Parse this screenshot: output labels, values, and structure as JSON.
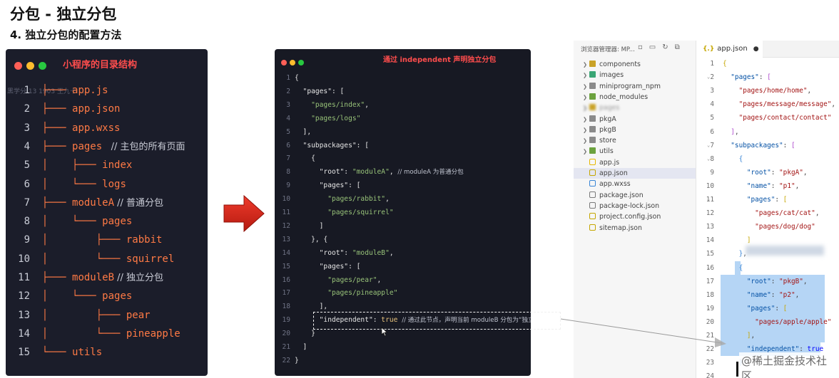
{
  "header": {
    "title": "分包 - 独立分包",
    "subtitle": "4. 独立分包的配置方法"
  },
  "tree_panel": {
    "title": "小程序的目录结构",
    "watermark": "黑学分 13 1903 王九十 ...",
    "lines": [
      {
        "num": "1",
        "prefix": "├─── ",
        "text": "app.js",
        "comment": ""
      },
      {
        "num": "2",
        "prefix": "├─── ",
        "text": "app.json",
        "comment": ""
      },
      {
        "num": "3",
        "prefix": "├─── ",
        "text": "app.wxss",
        "comment": ""
      },
      {
        "num": "4",
        "prefix": "├─── ",
        "text": "pages",
        "comment": "   // 主包的所有页面"
      },
      {
        "num": "5",
        "prefix": "│    ├─── ",
        "text": "index",
        "comment": ""
      },
      {
        "num": "6",
        "prefix": "│    └─── ",
        "text": "logs",
        "comment": ""
      },
      {
        "num": "7",
        "prefix": "├─── ",
        "text": "moduleA",
        "comment": " // 普通分包"
      },
      {
        "num": "8",
        "prefix": "│    └─── ",
        "text": "pages",
        "comment": ""
      },
      {
        "num": "9",
        "prefix": "│        ├─── ",
        "text": "rabbit",
        "comment": ""
      },
      {
        "num": "10",
        "prefix": "│        └─── ",
        "text": "squirrel",
        "comment": ""
      },
      {
        "num": "11",
        "prefix": "├─── ",
        "text": "moduleB",
        "comment": " // 独立分包"
      },
      {
        "num": "12",
        "prefix": "│    └─── ",
        "text": "pages",
        "comment": ""
      },
      {
        "num": "13",
        "prefix": "│        ├─── ",
        "text": "pear",
        "comment": ""
      },
      {
        "num": "14",
        "prefix": "│        └─── ",
        "text": "pineapple",
        "comment": ""
      },
      {
        "num": "15",
        "prefix": "└─── ",
        "text": "utils",
        "comment": ""
      }
    ]
  },
  "code_panel": {
    "title": "通过 independent 声明独立分包",
    "lines": [
      {
        "num": "1",
        "parts": [
          {
            "c": "k",
            "t": "{"
          }
        ]
      },
      {
        "num": "2",
        "parts": [
          {
            "c": "k",
            "t": "  \"pages\": ["
          }
        ]
      },
      {
        "num": "3",
        "parts": [
          {
            "c": "s",
            "t": "    \"pages/index\""
          },
          {
            "c": "k",
            "t": ","
          }
        ]
      },
      {
        "num": "4",
        "parts": [
          {
            "c": "s",
            "t": "    \"pages/logs\""
          }
        ]
      },
      {
        "num": "5",
        "parts": [
          {
            "c": "k",
            "t": "  ],"
          }
        ]
      },
      {
        "num": "6",
        "parts": [
          {
            "c": "k",
            "t": "  \"subpackages\": ["
          }
        ]
      },
      {
        "num": "7",
        "parts": [
          {
            "c": "k",
            "t": "    {"
          }
        ]
      },
      {
        "num": "8",
        "parts": [
          {
            "c": "k",
            "t": "      \"root\": "
          },
          {
            "c": "s",
            "t": "\"moduleA\""
          },
          {
            "c": "k",
            "t": ", "
          },
          {
            "c": "c",
            "t": "// moduleA 为普通分包"
          }
        ]
      },
      {
        "num": "9",
        "parts": [
          {
            "c": "k",
            "t": "      \"pages\": ["
          }
        ]
      },
      {
        "num": "10",
        "parts": [
          {
            "c": "s",
            "t": "        \"pages/rabbit\""
          },
          {
            "c": "k",
            "t": ","
          }
        ]
      },
      {
        "num": "11",
        "parts": [
          {
            "c": "s",
            "t": "        \"pages/squirrel\""
          }
        ]
      },
      {
        "num": "12",
        "parts": [
          {
            "c": "k",
            "t": "      ]"
          }
        ]
      },
      {
        "num": "13",
        "parts": [
          {
            "c": "k",
            "t": "    }, {"
          }
        ]
      },
      {
        "num": "14",
        "parts": [
          {
            "c": "k",
            "t": "      \"root\": "
          },
          {
            "c": "s",
            "t": "\"moduleB\""
          },
          {
            "c": "k",
            "t": ","
          }
        ]
      },
      {
        "num": "15",
        "parts": [
          {
            "c": "k",
            "t": "      \"pages\": ["
          }
        ]
      },
      {
        "num": "16",
        "parts": [
          {
            "c": "s",
            "t": "        \"pages/pear\""
          },
          {
            "c": "k",
            "t": ","
          }
        ]
      },
      {
        "num": "17",
        "parts": [
          {
            "c": "s",
            "t": "        \"pages/pineapple\""
          }
        ]
      },
      {
        "num": "18",
        "parts": [
          {
            "c": "k",
            "t": "      ],"
          }
        ]
      },
      {
        "num": "19",
        "parts": [
          {
            "c": "k",
            "t": "      \"independent\": "
          },
          {
            "c": "b",
            "t": "true"
          },
          {
            "c": "k",
            "t": " "
          },
          {
            "c": "c",
            "t": "// 通过此节点，声明当前 moduleB 分包为“独立分包”"
          }
        ]
      },
      {
        "num": "20",
        "parts": [
          {
            "c": "k",
            "t": "    }"
          }
        ]
      },
      {
        "num": "21",
        "parts": [
          {
            "c": "k",
            "t": "  ]"
          }
        ]
      },
      {
        "num": "22",
        "parts": [
          {
            "c": "k",
            "t": "}"
          }
        ]
      }
    ]
  },
  "explorer": {
    "header": "浏览器管理器: MP...",
    "items": [
      {
        "label": "components",
        "chevron": true,
        "icon": "folder-icon",
        "color": "#c9a227",
        "active": false,
        "blur": false
      },
      {
        "label": "images",
        "chevron": true,
        "icon": "folder-icon",
        "color": "#3aa675",
        "active": false,
        "blur": false
      },
      {
        "label": "miniprogram_npm",
        "chevron": true,
        "icon": "folder-icon",
        "color": "#8a8a8a",
        "active": false,
        "blur": false
      },
      {
        "label": "node_modules",
        "chevron": true,
        "icon": "folder-icon",
        "color": "#6ca23e",
        "active": false,
        "blur": false
      },
      {
        "label": "pages",
        "chevron": true,
        "icon": "folder-icon",
        "color": "#c9a227",
        "active": false,
        "blur": true
      },
      {
        "label": "pkgA",
        "chevron": true,
        "icon": "folder-icon",
        "color": "#8a8a8a",
        "active": false,
        "blur": false
      },
      {
        "label": "pkgB",
        "chevron": true,
        "icon": "folder-icon",
        "color": "#8a8a8a",
        "active": false,
        "blur": false
      },
      {
        "label": "store",
        "chevron": true,
        "icon": "folder-icon",
        "color": "#8a8a8a",
        "active": false,
        "blur": false
      },
      {
        "label": "utils",
        "chevron": true,
        "icon": "folder-icon",
        "color": "#6ca23e",
        "active": false,
        "blur": false
      },
      {
        "label": "app.js",
        "chevron": false,
        "icon": "js-file-icon",
        "color": "#e6b800",
        "active": false,
        "blur": false
      },
      {
        "label": "app.json",
        "chevron": false,
        "icon": "json-file-icon",
        "color": "#c5a600",
        "active": true,
        "blur": false
      },
      {
        "label": "app.wxss",
        "chevron": false,
        "icon": "css-file-icon",
        "color": "#3a86d6",
        "active": false,
        "blur": false
      },
      {
        "label": "package.json",
        "chevron": false,
        "icon": "npm-file-icon",
        "color": "#7a7a7a",
        "active": false,
        "blur": false
      },
      {
        "label": "package-lock.json",
        "chevron": false,
        "icon": "npm-file-icon",
        "color": "#7a7a7a",
        "active": false,
        "blur": false
      },
      {
        "label": "project.config.json",
        "chevron": false,
        "icon": "json-file-icon",
        "color": "#c5a600",
        "active": false,
        "blur": false
      },
      {
        "label": "sitemap.json",
        "chevron": false,
        "icon": "json-file-icon",
        "color": "#c5a600",
        "active": false,
        "blur": false
      }
    ]
  },
  "editor": {
    "tab": {
      "label": "app.json",
      "modified": "●"
    },
    "lines": [
      {
        "num": "1",
        "fold": "",
        "parts": [
          {
            "c": "ebr1",
            "t": "{"
          }
        ]
      },
      {
        "num": "2",
        "fold": "⌄",
        "parts": [
          {
            "c": "ek",
            "t": "  \"pages\""
          },
          {
            "c": "ep",
            "t": ": "
          },
          {
            "c": "ebr2",
            "t": "["
          }
        ]
      },
      {
        "num": "3",
        "fold": "",
        "parts": [
          {
            "c": "es",
            "t": "    \"pages/home/home\""
          },
          {
            "c": "ep",
            "t": ","
          }
        ]
      },
      {
        "num": "4",
        "fold": "",
        "parts": [
          {
            "c": "es",
            "t": "    \"pages/message/message\""
          },
          {
            "c": "ep",
            "t": ","
          }
        ]
      },
      {
        "num": "5",
        "fold": "",
        "parts": [
          {
            "c": "es",
            "t": "    \"pages/contact/contact\""
          }
        ]
      },
      {
        "num": "6",
        "fold": "",
        "parts": [
          {
            "c": "ebr2",
            "t": "  ]"
          },
          {
            "c": "ep",
            "t": ","
          }
        ]
      },
      {
        "num": "7",
        "fold": "⌄",
        "parts": [
          {
            "c": "ek",
            "t": "  \"subpackages\""
          },
          {
            "c": "ep",
            "t": ": "
          },
          {
            "c": "ebr2",
            "t": "["
          }
        ]
      },
      {
        "num": "8",
        "fold": "⌄",
        "parts": [
          {
            "c": "ebr3",
            "t": "    {"
          }
        ]
      },
      {
        "num": "9",
        "fold": "",
        "parts": [
          {
            "c": "ek",
            "t": "      \"root\""
          },
          {
            "c": "ep",
            "t": ": "
          },
          {
            "c": "es",
            "t": "\"pkgA\""
          },
          {
            "c": "ep",
            "t": ","
          }
        ]
      },
      {
        "num": "10",
        "fold": "",
        "parts": [
          {
            "c": "ek",
            "t": "      \"name\""
          },
          {
            "c": "ep",
            "t": ": "
          },
          {
            "c": "es",
            "t": "\"p1\""
          },
          {
            "c": "ep",
            "t": ","
          }
        ]
      },
      {
        "num": "11",
        "fold": "⌄",
        "parts": [
          {
            "c": "ek",
            "t": "      \"pages\""
          },
          {
            "c": "ep",
            "t": ": "
          },
          {
            "c": "ebr1",
            "t": "["
          }
        ]
      },
      {
        "num": "12",
        "fold": "",
        "parts": [
          {
            "c": "es",
            "t": "        \"pages/cat/cat\""
          },
          {
            "c": "ep",
            "t": ","
          }
        ]
      },
      {
        "num": "13",
        "fold": "",
        "parts": [
          {
            "c": "es",
            "t": "        \"pages/dog/dog\""
          }
        ]
      },
      {
        "num": "14",
        "fold": "",
        "parts": [
          {
            "c": "ebr1",
            "t": "      ]"
          }
        ]
      },
      {
        "num": "15",
        "fold": "",
        "parts": [
          {
            "c": "ebr3",
            "t": "    }"
          },
          {
            "c": "ep",
            "t": ","
          }
        ]
      },
      {
        "num": "16",
        "fold": "⌄",
        "parts": [
          {
            "c": "ebr3",
            "t": "    {"
          }
        ]
      },
      {
        "num": "17",
        "fold": "",
        "parts": [
          {
            "c": "ek",
            "t": "      \"root\""
          },
          {
            "c": "ep",
            "t": ": "
          },
          {
            "c": "es",
            "t": "\"pkgB\""
          },
          {
            "c": "ep",
            "t": ","
          }
        ]
      },
      {
        "num": "18",
        "fold": "",
        "parts": [
          {
            "c": "ek",
            "t": "      \"name\""
          },
          {
            "c": "ep",
            "t": ": "
          },
          {
            "c": "es",
            "t": "\"p2\""
          },
          {
            "c": "ep",
            "t": ","
          }
        ]
      },
      {
        "num": "19",
        "fold": "⌄",
        "parts": [
          {
            "c": "ek",
            "t": "      \"pages\""
          },
          {
            "c": "ep",
            "t": ": "
          },
          {
            "c": "ebr1",
            "t": "["
          }
        ]
      },
      {
        "num": "20",
        "fold": "",
        "parts": [
          {
            "c": "es",
            "t": "        \"pages/apple/apple\""
          }
        ]
      },
      {
        "num": "21",
        "fold": "",
        "parts": [
          {
            "c": "ebr1",
            "t": "      ]"
          },
          {
            "c": "ep",
            "t": ","
          }
        ]
      },
      {
        "num": "22",
        "fold": "",
        "parts": [
          {
            "c": "ek",
            "t": "      \"independent\""
          },
          {
            "c": "ep",
            "t": ": "
          },
          {
            "c": "eb",
            "t": "true"
          }
        ]
      },
      {
        "num": "23",
        "fold": "",
        "parts": [
          {
            "c": "ebr3",
            "t": "    }"
          }
        ]
      },
      {
        "num": "24",
        "fold": "",
        "parts": [
          {
            "c": "ep",
            "t": "  "
          }
        ]
      }
    ]
  },
  "watermark": "@稀土掘金技术社区",
  "colors": {
    "tree_bg": "#1b1d2a",
    "code_bg": "#171923",
    "accent_red": "#ff4d4d",
    "tree_text": "#ff7a45",
    "selection": "#b5d5f5",
    "arrow": "#d42a1e"
  }
}
